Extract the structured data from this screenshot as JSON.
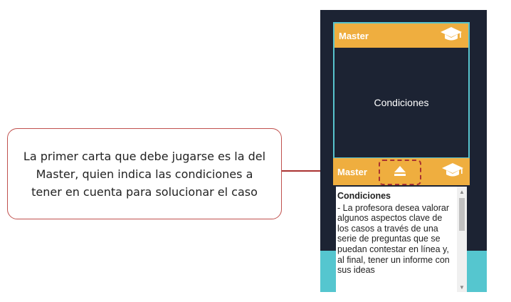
{
  "callout": {
    "text": "La primer carta que debe jugarse es la del Master, quien indica las condiciones a tener en cuenta para solucionar el caso"
  },
  "top_card": {
    "header_title": "Master",
    "header_icon": "graduation-cap-icon",
    "body_text": "Condiciones"
  },
  "bottom_card": {
    "header_title": "Master",
    "header_icon": "graduation-cap-icon",
    "eject_icon": "eject-icon",
    "content_heading": "Condiciones",
    "content_text": "- La profesora desea valorar algunos aspectos clave de los casos a través de una serie de preguntas que se puedan contestar en línea y, al final, tener un informe con sus ideas"
  },
  "colors": {
    "panel_bg": "#1c2333",
    "card_header": "#efae3f",
    "card_border": "#57c3cd",
    "teal": "#55c6cf",
    "callout_border": "#c0504d"
  }
}
